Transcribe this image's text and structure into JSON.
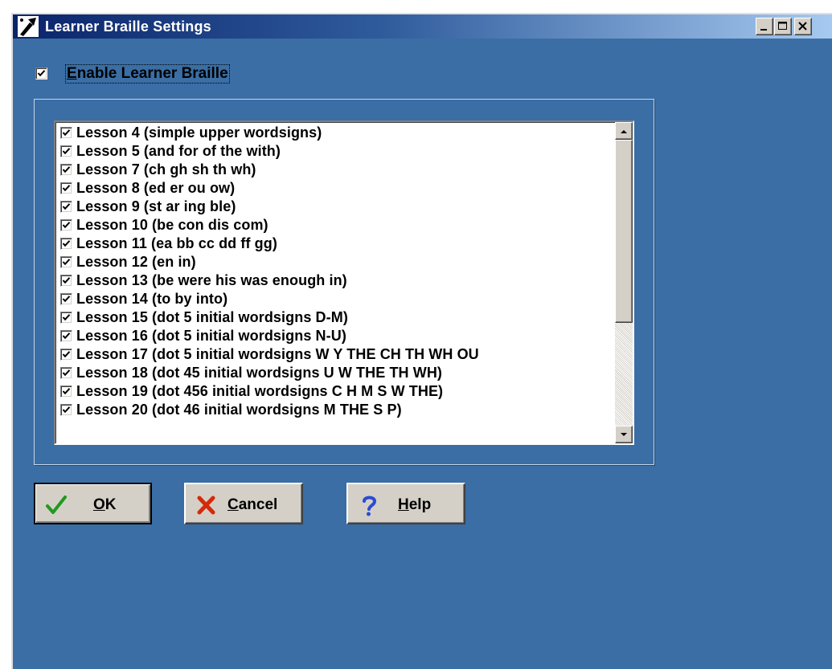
{
  "window": {
    "title": "Learner Braille Settings",
    "icon": "braille-app-icon",
    "controls": [
      "minimize-icon",
      "maximize-icon",
      "close-icon"
    ]
  },
  "enable": {
    "checked": true,
    "label_mnemonic": "E",
    "label_rest": "nable Learner Braille"
  },
  "lessons": {
    "items": [
      {
        "label": "Lesson 4 (simple upper wordsigns)",
        "checked": true
      },
      {
        "label": "Lesson 5 (and for of the with)",
        "checked": true
      },
      {
        "label": "Lesson 7 (ch gh sh th wh)",
        "checked": true
      },
      {
        "label": "Lesson 8 (ed er ou ow)",
        "checked": true
      },
      {
        "label": "Lesson 9 (st ar ing ble)",
        "checked": true
      },
      {
        "label": "Lesson 10 (be con dis com)",
        "checked": true
      },
      {
        "label": "Lesson 11 (ea bb cc dd ff gg)",
        "checked": true
      },
      {
        "label": "Lesson 12 (en in)",
        "checked": true
      },
      {
        "label": "Lesson 13 (be were his was enough in)",
        "checked": true
      },
      {
        "label": "Lesson 14 (to by into)",
        "checked": true
      },
      {
        "label": "Lesson 15 (dot 5 initial wordsigns D-M)",
        "checked": true
      },
      {
        "label": "Lesson 16 (dot 5 initial wordsigns N-U)",
        "checked": true
      },
      {
        "label": "Lesson 17 (dot 5 initial wordsigns W Y THE CH TH WH OU",
        "checked": true
      },
      {
        "label": "Lesson 18 (dot 45 initial wordsigns U W THE TH WH)",
        "checked": true
      },
      {
        "label": "Lesson 19 (dot 456 initial wordsigns C H M S W THE)",
        "checked": true
      },
      {
        "label": "Lesson 20 (dot 46 initial wordsigns M THE S P)",
        "checked": true
      }
    ],
    "scroll_position": 0.0
  },
  "buttons": {
    "ok": {
      "mnemonic": "O",
      "rest": "K",
      "icon": "checkmark-icon",
      "color": "#1f9a1f"
    },
    "cancel": {
      "mnemonic": "C",
      "rest": "ancel",
      "icon": "x-icon",
      "color": "#d42a0a"
    },
    "help": {
      "mnemonic": "H",
      "rest": "elp",
      "icon": "question-mark-icon",
      "color": "#2a4bd4"
    }
  },
  "colors": {
    "client_background": "#3a6ea5",
    "title_gradient_start": "#0a246a",
    "title_gradient_end": "#a6caf0",
    "face": "#d4d0c8"
  }
}
